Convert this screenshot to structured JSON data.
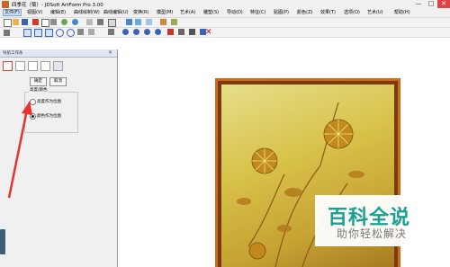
{
  "window": {
    "title": "四季花（菊）- JDSoft ArtForm Pro 3.00",
    "minimize_glyph": "—",
    "maximize_glyph": "□",
    "close_glyph": "✕"
  },
  "menubar": {
    "items": [
      {
        "label": "文件(F)"
      },
      {
        "label": "视图(V)"
      },
      {
        "label": "编辑(E)"
      },
      {
        "label": "曲线绘制(W)"
      },
      {
        "label": "曲线编辑(U)"
      },
      {
        "label": "变换(R)"
      },
      {
        "label": "模型(M)"
      },
      {
        "label": "艺术(A)"
      },
      {
        "label": "雕塑(S)"
      },
      {
        "label": "导动(D)"
      },
      {
        "label": "特征(C)"
      },
      {
        "label": "贴图(P)"
      },
      {
        "label": "颜色(Z)"
      },
      {
        "label": "效果(T)"
      },
      {
        "label": "选项(O)"
      },
      {
        "label": "艺术(U)"
      },
      {
        "label": "帮助(H)"
      }
    ]
  },
  "panel": {
    "title": "导航工作条",
    "close_glyph": "×",
    "confirm_label": "确定",
    "cancel_label": "取消",
    "group_label": "高度/颜色",
    "option_height": "高度作为位图",
    "option_color": "颜色作为位图"
  },
  "watermark": {
    "title": "百科全说",
    "subtitle": "助你轻松解决"
  },
  "colors": {
    "frame": "#cf6a1a",
    "carving": "#d8c24a",
    "watermark_accent": "#1aa094",
    "annotation_arrow": "#e8332c"
  }
}
